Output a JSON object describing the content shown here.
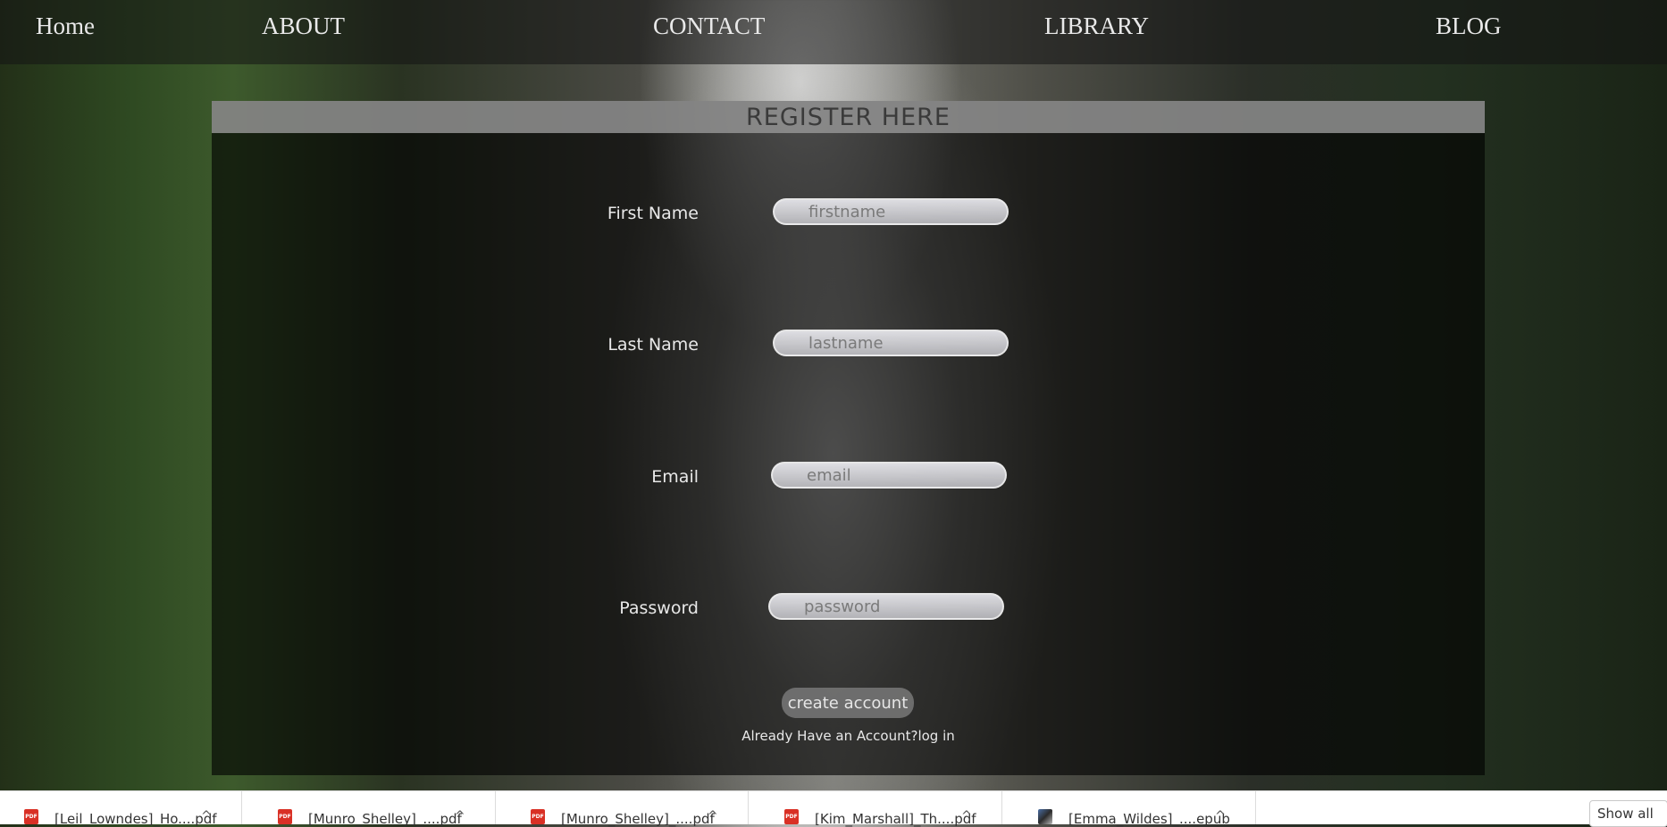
{
  "nav": {
    "home": "Home",
    "about": "ABOUT",
    "contact": "CONTACT",
    "library": "LIBRARY",
    "blog": "BLOG"
  },
  "form": {
    "title": "REGISTER HERE",
    "first_name": {
      "label": "First Name",
      "placeholder": "firstname"
    },
    "last_name": {
      "label": "Last Name",
      "placeholder": "lastname"
    },
    "email": {
      "label": "Email",
      "placeholder": "email"
    },
    "password": {
      "label": "Password",
      "placeholder": "password"
    },
    "submit_label": "create account",
    "login_prompt": "Already Have an Account?",
    "login_link": "log in"
  },
  "downloads": {
    "items": [
      {
        "name": "[Leil_Lowndes]_Ho....pdf",
        "icon": "pdf-file-icon",
        "icon_text": "PDF"
      },
      {
        "name": "[Munro_Shelley]_....pdf",
        "icon": "pdf-file-icon",
        "icon_text": "PDF"
      },
      {
        "name": "[Munro_Shelley]_....pdf",
        "icon": "pdf-file-icon",
        "icon_text": "PDF"
      },
      {
        "name": "[Kim_Marshall]_Th....pdf",
        "icon": "pdf-file-icon",
        "icon_text": "PDF"
      },
      {
        "name": "[Emma_Wildes]_....epub",
        "icon": "epub-file-icon",
        "icon_text": ""
      }
    ],
    "chevron": "^",
    "show_all": "Show all"
  }
}
